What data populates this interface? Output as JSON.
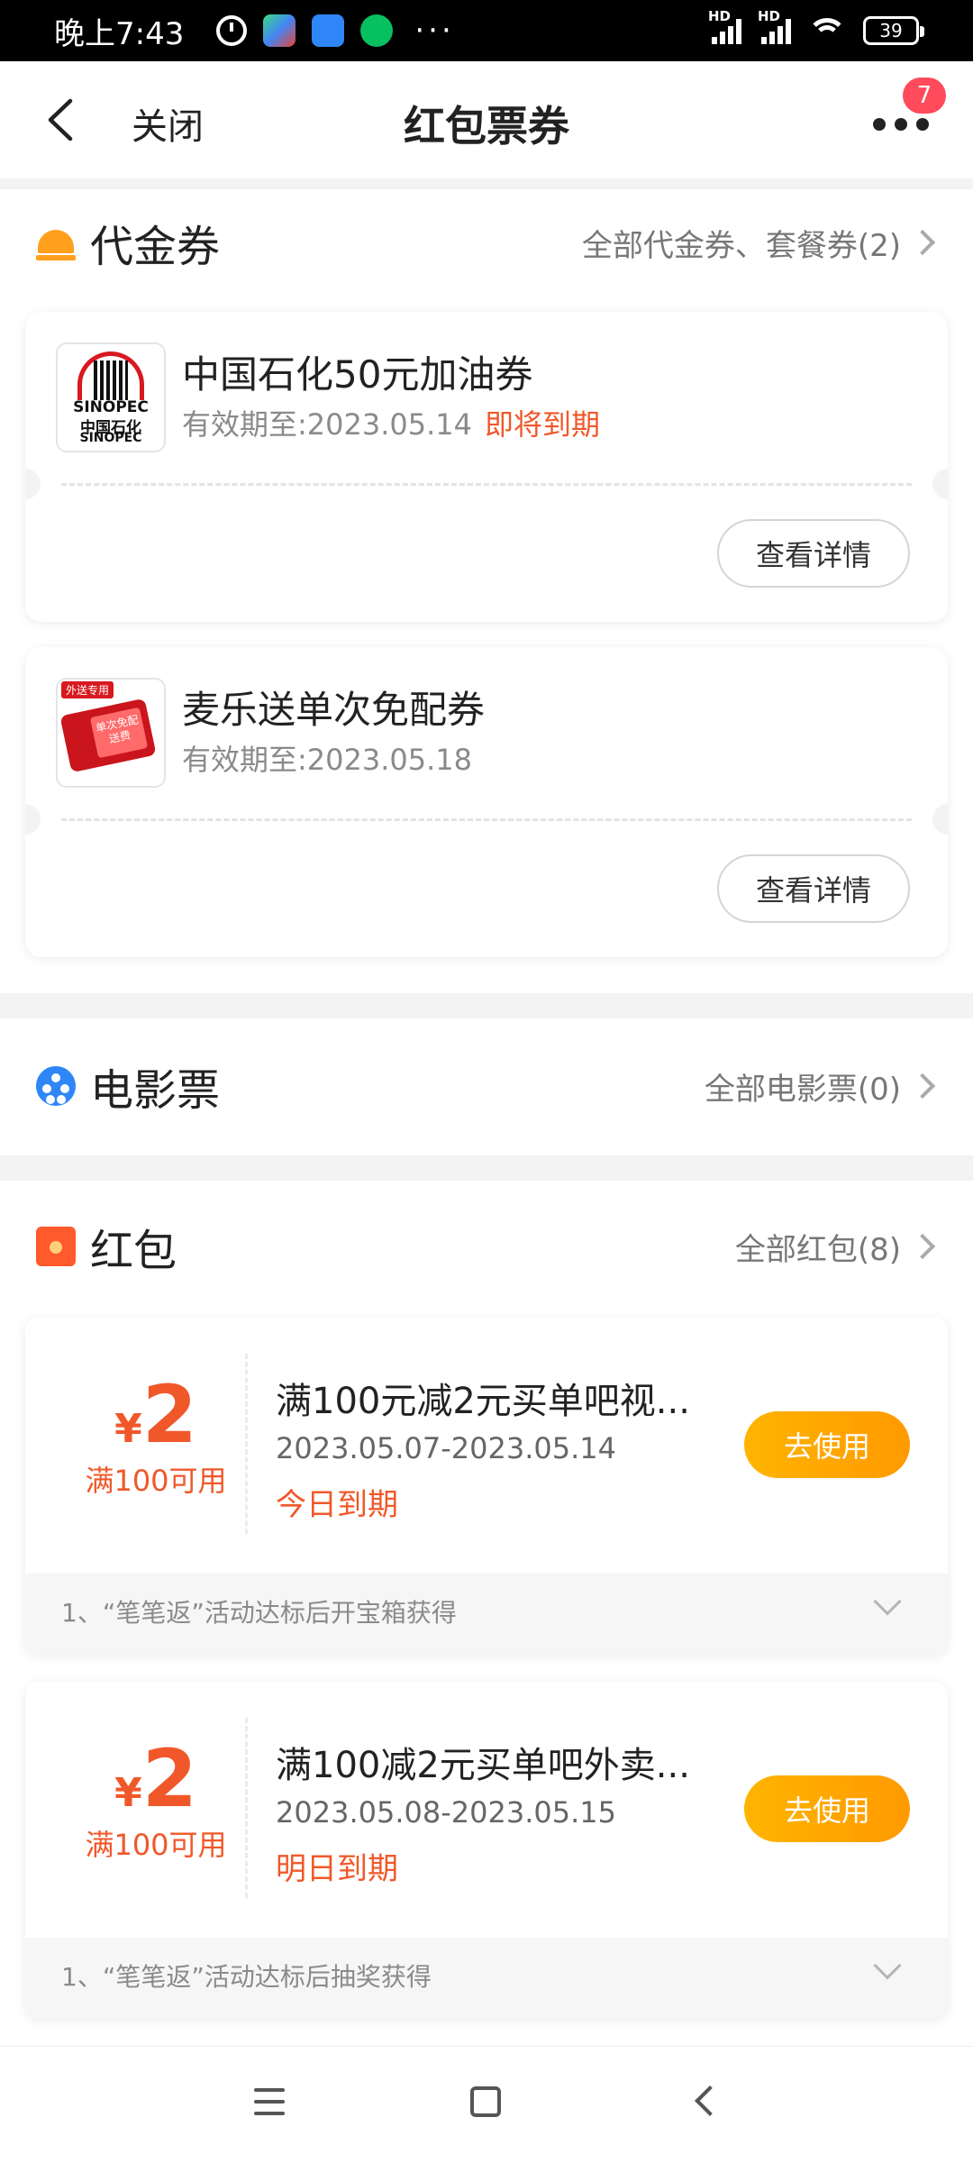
{
  "status_bar": {
    "time": "晚上7:43",
    "more": "···",
    "network_1": "HD",
    "network_2": "HD",
    "battery": "39"
  },
  "nav": {
    "close_label": "关闭",
    "title": "红包票券",
    "badge_count": "7"
  },
  "vouchers": {
    "title": "代金券",
    "link": "全部代金券、套餐券(2)",
    "items": [
      {
        "name": "中国石化50元加油券",
        "validity": "有效期至:2023.05.14",
        "warning": "即将到期",
        "detail_label": "查看详情",
        "logo": {
          "brand_en": "SINOPEC",
          "brand_cn": "中国石化",
          "brand_en2": "SINOPEC"
        }
      },
      {
        "name": "麦乐送单次免配券",
        "validity": "有效期至:2023.05.18",
        "warning": "",
        "detail_label": "查看详情",
        "logo": {
          "tag": "外送专用",
          "ticket": "单次免配送费"
        }
      }
    ]
  },
  "movies": {
    "title": "电影票",
    "link": "全部电影票(0)"
  },
  "red_packets": {
    "title": "红包",
    "link": "全部红包(8)",
    "items": [
      {
        "currency": "¥",
        "amount": "2",
        "condition": "满100可用",
        "title": "满100元减2元买单吧视...",
        "date_range": "2023.05.07-2023.05.14",
        "expire": "今日到期",
        "use_label": "去使用",
        "note": "1、“笔笔返”活动达标后开宝箱获得"
      },
      {
        "currency": "¥",
        "amount": "2",
        "condition": "满100可用",
        "title": "满100减2元买单吧外卖...",
        "date_range": "2023.05.08-2023.05.15",
        "expire": "明日到期",
        "use_label": "去使用",
        "note": "1、“笔笔返”活动达标后抽奖获得"
      }
    ]
  },
  "colors": {
    "accent": "#f0582a",
    "button": "#ffa800",
    "badge": "#ff4b5c"
  }
}
